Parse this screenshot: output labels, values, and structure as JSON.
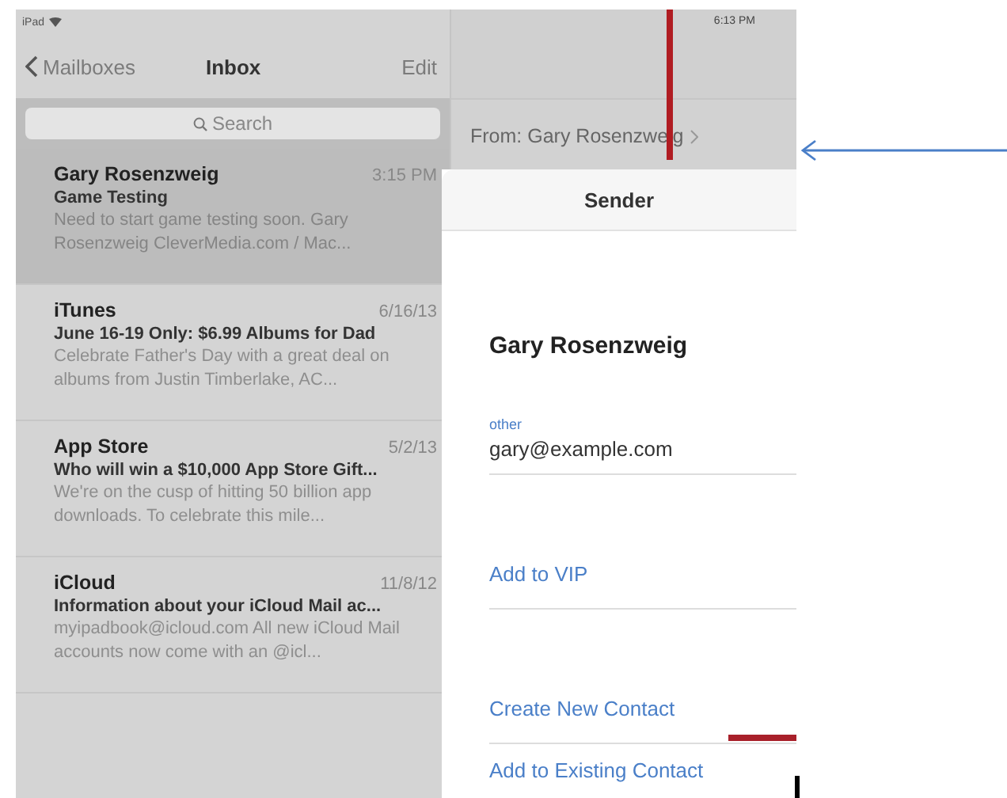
{
  "status_bar": {
    "device": "iPad",
    "time": "6:13 PM"
  },
  "nav": {
    "back": "Mailboxes",
    "title": "Inbox",
    "action": "Edit"
  },
  "search": {
    "placeholder": "Search"
  },
  "messages": [
    {
      "sender": "Gary Rosenzweig",
      "date": "3:15 PM",
      "subject": "Game Testing",
      "preview": "Need to start game testing soon. Gary Rosenzweig CleverMedia.com / Mac...",
      "selected": true
    },
    {
      "sender": "iTunes",
      "date": "6/16/13",
      "subject": "June 16-19 Only: $6.99 Albums for Dad",
      "preview": "Celebrate Father's Day with a great deal on albums from Justin Timberlake, AC...",
      "selected": false
    },
    {
      "sender": "App Store",
      "date": "5/2/13",
      "subject": "Who will win a $10,000 App Store Gift...",
      "preview": "We're on the cusp of hitting 50 billion app downloads. To celebrate this mile...",
      "selected": false
    },
    {
      "sender": "iCloud",
      "date": "11/8/12",
      "subject": "Information about your iCloud Mail ac...",
      "preview": "myipadbook@icloud.com All new iCloud Mail accounts now come with an @icl...",
      "selected": false
    }
  ],
  "detail": {
    "from": "From: Gary Rosenzweig"
  },
  "popover": {
    "title": "Sender",
    "name": "Gary Rosenzweig",
    "email_label": "other",
    "email": "gary@example.com",
    "actions": [
      "Add to VIP",
      "Create New Contact",
      "Add to Existing Contact"
    ]
  },
  "annotations": [
    {
      "kind": "vline",
      "color": "#b01c22"
    },
    {
      "kind": "arrow",
      "color": "#4a7fc8"
    },
    {
      "kind": "dash",
      "color": "#a8202a"
    },
    {
      "kind": "tick",
      "color": "#000000"
    }
  ]
}
